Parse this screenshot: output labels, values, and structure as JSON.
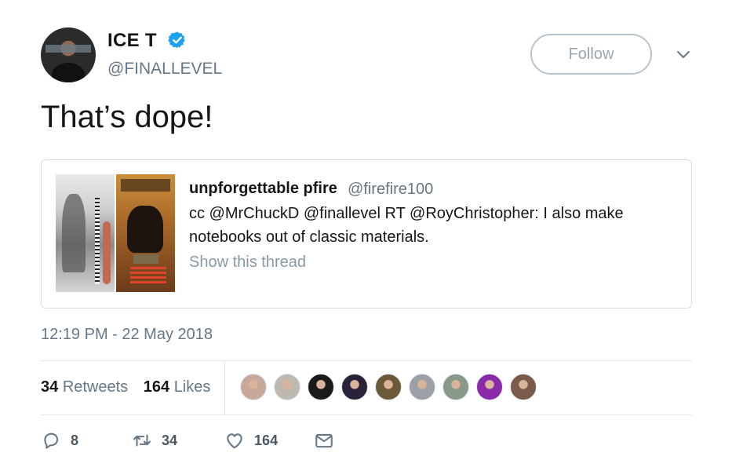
{
  "author": {
    "name": "ICE T",
    "handle": "@FINALLEVEL"
  },
  "follow_label": "Follow",
  "tweet_text": "That’s dope!",
  "quoted": {
    "name": "unpforgettable pfire",
    "handle": "@firefire100",
    "text": "cc @MrChuckD @finallevel RT @RoyChristopher: I also make notebooks out of classic materials.",
    "thread_link": "Show this thread"
  },
  "timestamp": "12:19 PM - 22 May 2018",
  "stats": {
    "retweets_count": "34",
    "retweets_label": "Retweets",
    "likes_count": "164",
    "likes_label": "Likes"
  },
  "actions": {
    "replies": "8",
    "retweets": "34",
    "likes": "164"
  },
  "colors": {
    "verified": "#1da1f2",
    "muted": "#657786"
  },
  "liker_colors": [
    "#c8a89a",
    "#bfb8b0",
    "#1a1a1a",
    "#2a2238",
    "#6b5a3a",
    "#9aa0a6",
    "#8a9a8a",
    "#8a2aa8",
    "#7a5a4a"
  ]
}
